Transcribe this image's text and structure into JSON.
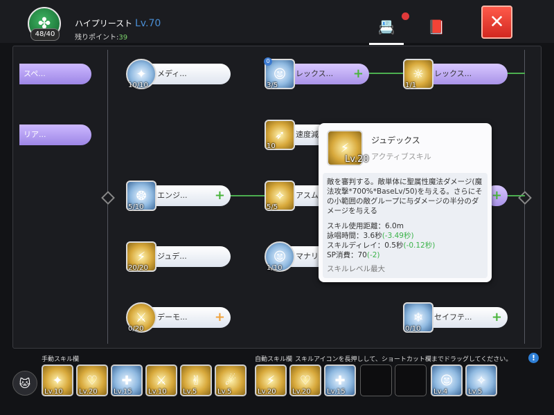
{
  "header": {
    "class_name": "ハイプリースト",
    "level": "Lv.70",
    "remain_label": "残りポイント:",
    "remain_value": "39",
    "class_points": "48/40",
    "class_icon": "clover-icon"
  },
  "tabs": [
    {
      "name": "skill-book",
      "icon": "contacts-book-icon",
      "active": true
    },
    {
      "name": "notebook",
      "icon": "book-icon",
      "active": false
    }
  ],
  "close_icon": "✕",
  "left_column": [
    {
      "label": "スペ..."
    },
    {
      "label": "リア..."
    }
  ],
  "skills": [
    {
      "name": "メディ...",
      "level": "10/10",
      "plus": ""
    },
    {
      "name": "レックス...",
      "level": "3/5",
      "plus": "+"
    },
    {
      "name": "レックス...",
      "level": "1/1",
      "plus": ""
    },
    {
      "name": "速度減...",
      "level": "10",
      "plus": ""
    },
    {
      "name": "エンジ...",
      "level": "5/10",
      "plus": "+"
    },
    {
      "name": "アスム...",
      "level": "5/5",
      "plus": ""
    },
    {
      "name": "ジュデ...",
      "level": "20/20",
      "plus": ""
    },
    {
      "name": "マナリ...",
      "level": "1/10",
      "plus": ""
    },
    {
      "name": "デーモ...",
      "level": "0/20",
      "plus": "+"
    },
    {
      "name": "セイフテ...",
      "level": "0/10",
      "plus": "+"
    }
  ],
  "tooltip": {
    "name": "ジュデックス",
    "level": "Lv.20",
    "type": "アクティブスキル",
    "description": "敵を審判する。敵単体に聖属性魔法ダメージ(魔法攻撃*700%*BaseLv/50)を与える。さらにその小範囲の敵グループに与ダメージの半分のダメージを与える",
    "stats": [
      {
        "label": "スキル使用距離：6.0m",
        "bonus": ""
      },
      {
        "label": "詠唱時間：3.6秒",
        "bonus": "(-3.49秒)"
      },
      {
        "label": "スキルディレイ：0.5秒",
        "bonus": "(-0.12秒)"
      },
      {
        "label": "SP消費：70",
        "bonus": "(-2)"
      }
    ],
    "footer": "スキルレベル最大"
  },
  "bottom": {
    "manual_label": "手動スキル欄",
    "auto_label": "自動スキル欄",
    "hint": "スキルアイコンを長押しして、ショートカット欄までドラッグしてください。",
    "help": "!",
    "avatar_icon": "cat-face-icon",
    "slots": [
      {
        "level": "Lv.10",
        "type": "gold"
      },
      {
        "level": "Lv.20",
        "type": "gold"
      },
      {
        "level": "Lv.15",
        "type": "blue"
      },
      {
        "level": "Lv.10",
        "type": "gold"
      },
      {
        "level": "Lv.5",
        "type": "gold"
      },
      {
        "level": "Lv.5",
        "type": "gold"
      },
      {
        "level": "Lv.20",
        "type": "gold"
      },
      {
        "level": "Lv.20",
        "type": "gold"
      },
      {
        "level": "Lv.15",
        "type": "blue"
      },
      {
        "level": "",
        "type": "empty"
      },
      {
        "level": "",
        "type": "empty"
      },
      {
        "level": "Lv.4",
        "type": "blue"
      },
      {
        "level": "Lv.5",
        "type": "blue"
      }
    ]
  },
  "colors": {
    "accent_green": "#49b43b",
    "accent_orange": "#f0a23a",
    "close_red": "#e63a2e",
    "level_blue": "#4a8fd6"
  }
}
